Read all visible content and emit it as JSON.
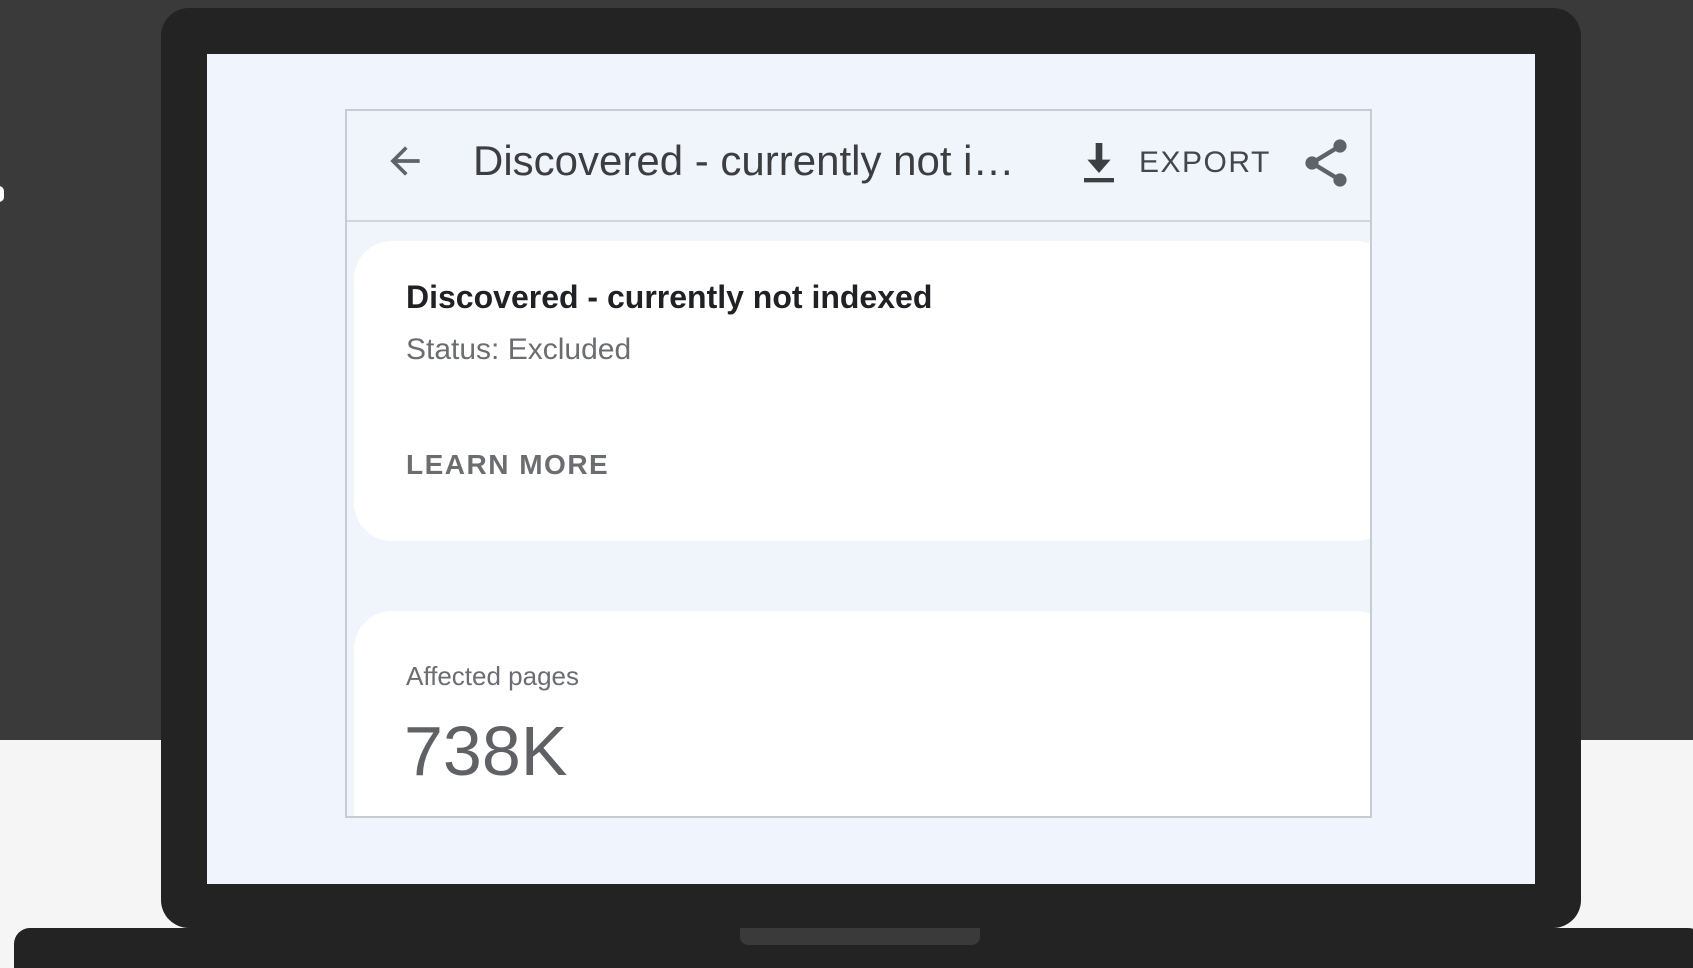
{
  "header": {
    "title": "Discovered - currently not indexed",
    "export_label": "EXPORT",
    "back_icon": "arrow-back-icon",
    "export_icon": "download-icon",
    "share_icon": "share-icon"
  },
  "issue_card": {
    "title": "Discovered - currently not indexed",
    "status": "Status: Excluded",
    "learn_more_label": "LEARN MORE"
  },
  "metric_card": {
    "label": "Affected pages",
    "value": "738K"
  },
  "colors": {
    "screen_background": "#f0f4fc",
    "card_background": "#ffffff",
    "device_frame": "#232323",
    "backdrop_dark": "#3a3a3a",
    "text_primary": "#202124",
    "text_secondary": "#6b6d71"
  }
}
